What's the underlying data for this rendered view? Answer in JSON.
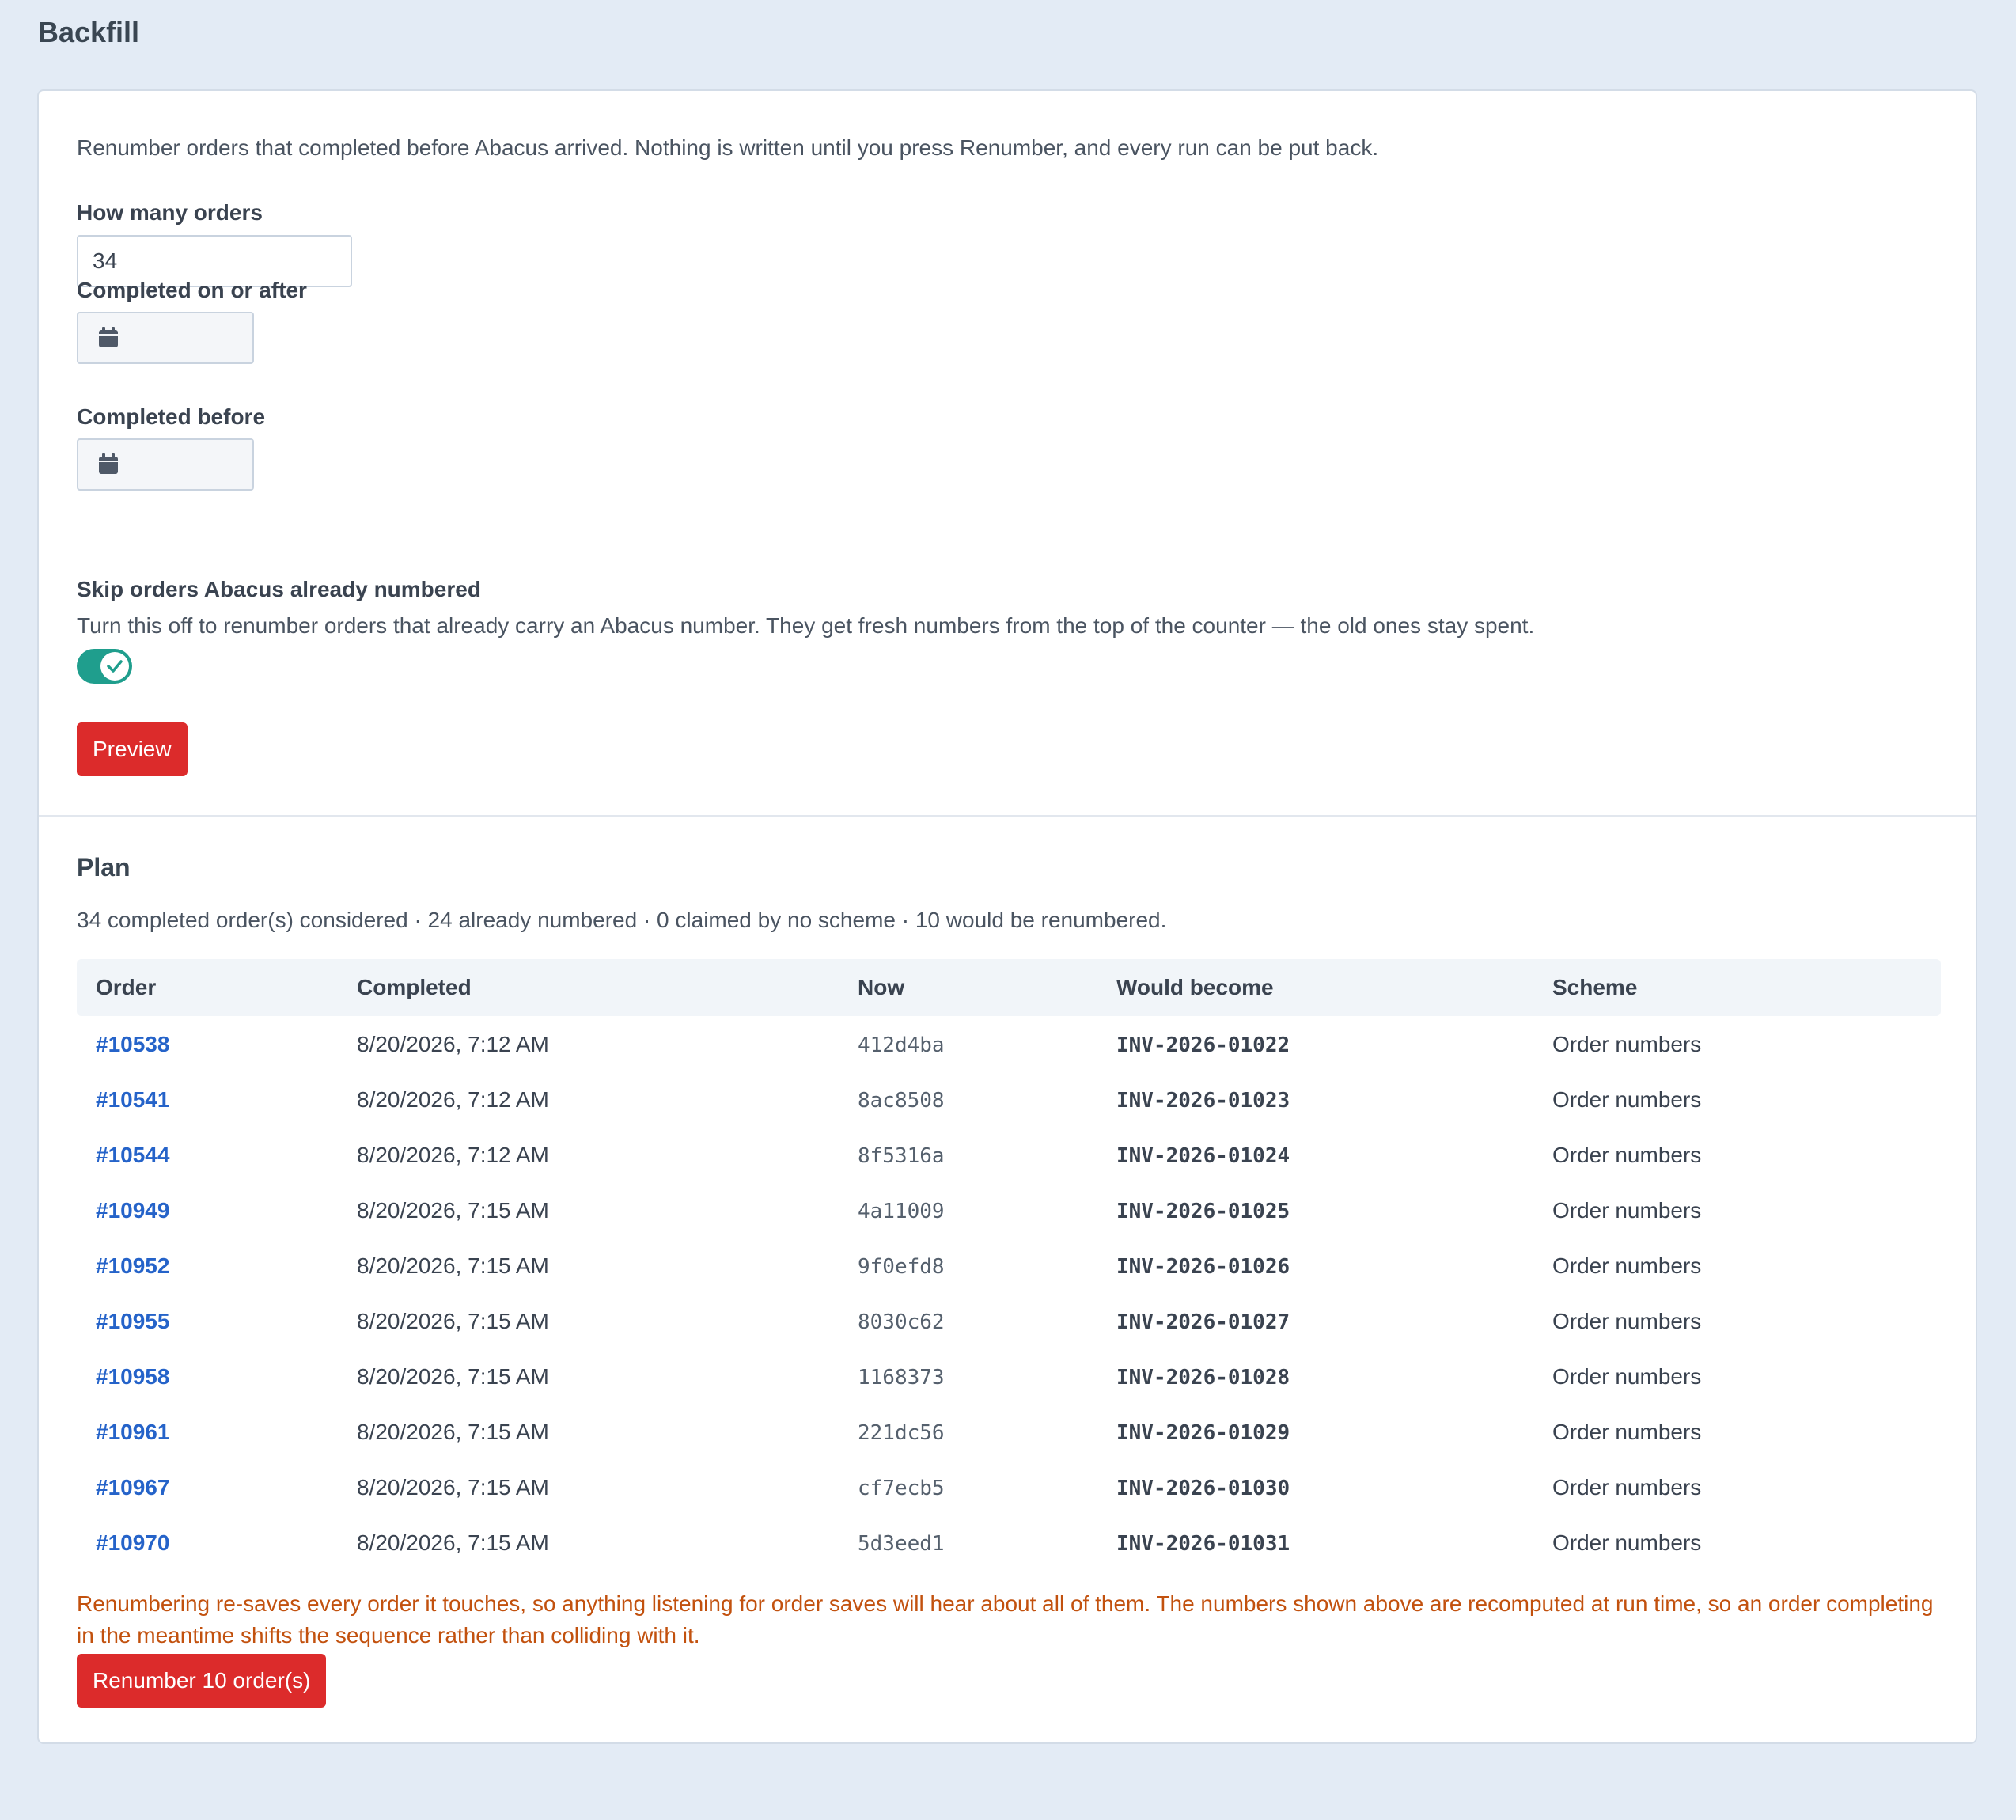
{
  "page": {
    "title": "Backfill"
  },
  "form": {
    "intro": "Renumber orders that completed before Abacus arrived. Nothing is written until you press Renumber, and every run can be put back.",
    "how_many_label": "How many orders",
    "how_many_value": "34",
    "completed_after_label": "Completed on or after",
    "completed_after_value": "",
    "completed_before_label": "Completed before",
    "completed_before_value": "",
    "skip_label": "Skip orders Abacus already numbered",
    "skip_help": "Turn this off to renumber orders that already carry an Abacus number. They get fresh numbers from the top of the counter — the old ones stay spent.",
    "skip_enabled": true,
    "preview_button": "Preview"
  },
  "plan": {
    "title": "Plan",
    "summary": "34 completed order(s) considered · 24 already numbered · 0 claimed by no scheme · 10 would be renumbered.",
    "columns": [
      "Order",
      "Completed",
      "Now",
      "Would become",
      "Scheme"
    ],
    "rows": [
      {
        "order": "#10538",
        "completed": "8/20/2026, 7:12 AM",
        "now": "412d4ba",
        "would_become": "INV-2026-01022",
        "scheme": "Order numbers"
      },
      {
        "order": "#10541",
        "completed": "8/20/2026, 7:12 AM",
        "now": "8ac8508",
        "would_become": "INV-2026-01023",
        "scheme": "Order numbers"
      },
      {
        "order": "#10544",
        "completed": "8/20/2026, 7:12 AM",
        "now": "8f5316a",
        "would_become": "INV-2026-01024",
        "scheme": "Order numbers"
      },
      {
        "order": "#10949",
        "completed": "8/20/2026, 7:15 AM",
        "now": "4a11009",
        "would_become": "INV-2026-01025",
        "scheme": "Order numbers"
      },
      {
        "order": "#10952",
        "completed": "8/20/2026, 7:15 AM",
        "now": "9f0efd8",
        "would_become": "INV-2026-01026",
        "scheme": "Order numbers"
      },
      {
        "order": "#10955",
        "completed": "8/20/2026, 7:15 AM",
        "now": "8030c62",
        "would_become": "INV-2026-01027",
        "scheme": "Order numbers"
      },
      {
        "order": "#10958",
        "completed": "8/20/2026, 7:15 AM",
        "now": "1168373",
        "would_become": "INV-2026-01028",
        "scheme": "Order numbers"
      },
      {
        "order": "#10961",
        "completed": "8/20/2026, 7:15 AM",
        "now": "221dc56",
        "would_become": "INV-2026-01029",
        "scheme": "Order numbers"
      },
      {
        "order": "#10967",
        "completed": "8/20/2026, 7:15 AM",
        "now": "cf7ecb5",
        "would_become": "INV-2026-01030",
        "scheme": "Order numbers"
      },
      {
        "order": "#10970",
        "completed": "8/20/2026, 7:15 AM",
        "now": "5d3eed1",
        "would_become": "INV-2026-01031",
        "scheme": "Order numbers"
      }
    ],
    "warning": "Renumbering re-saves every order it touches, so anything listening for order saves will hear about all of them. The numbers shown above are recomputed at run time, so an order completing in the meantime shifts the sequence rather than colliding with it.",
    "renumber_button": "Renumber 10 order(s)"
  },
  "colors": {
    "accent": "#dc2b2b",
    "toggle_on": "#1f9e8d",
    "link": "#2563c9",
    "warning": "#c2510e",
    "background": "#e3ebf5"
  },
  "icons": {
    "date_field": "calendar-icon",
    "toggle_knob": "check-icon"
  }
}
